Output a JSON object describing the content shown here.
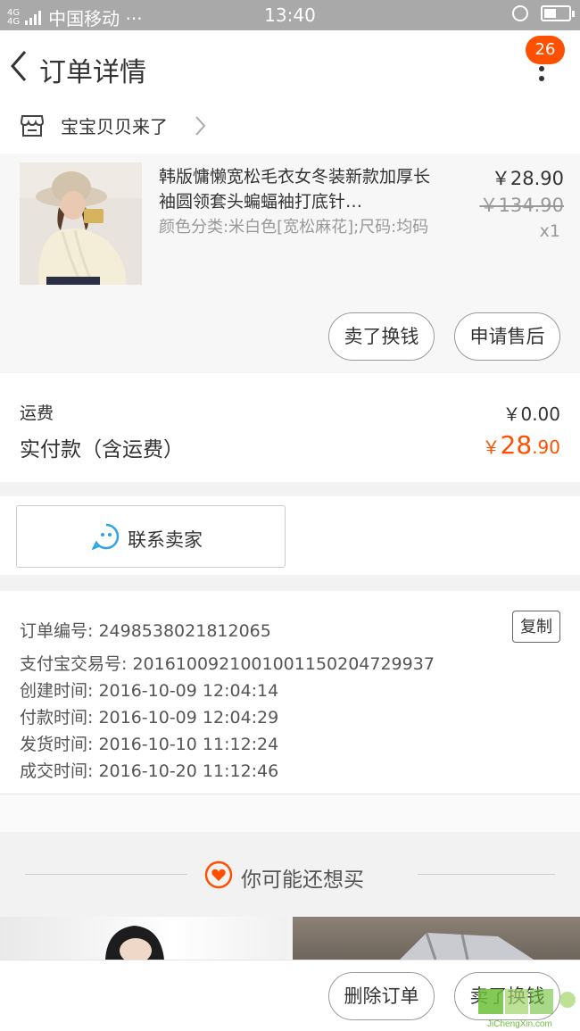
{
  "status_bar": {
    "network": "4G\n4G",
    "carrier": "中国移动 ···",
    "time": "13:40"
  },
  "nav": {
    "title": "订单详情",
    "badge_count": "26"
  },
  "shop": {
    "name": "宝宝贝贝来了"
  },
  "item": {
    "title": "韩版慵懒宽松毛衣女冬装新款加厚长袖圆领套头蝙蝠袖打底针…",
    "sku": "颜色分类:米白色[宽松麻花];尺码:均码",
    "price": "￥28.90",
    "original_price": "￥134.90",
    "quantity": "x1",
    "buttons": {
      "sell": "卖了换钱",
      "after_sale": "申请售后"
    }
  },
  "payment": {
    "shipping_label": "运费",
    "shipping_value": "￥0.00",
    "paid_label": "实付款（含运费）",
    "paid_currency": "￥",
    "paid_int": "28",
    "paid_dec": ".90"
  },
  "contact": {
    "label": "联系卖家"
  },
  "order_info": {
    "copy_label": "复制",
    "rows": [
      "订单编号: 2498538021812065",
      "支付宝交易号: 2016100921001001150204729937",
      "创建时间: 2016-10-09 12:04:14",
      "付款时间: 2016-10-09 12:04:29",
      "发货时间: 2016-10-10 11:12:24",
      "成交时间: 2016-10-20 11:12:46"
    ]
  },
  "recommend": {
    "title": "你可能还想买"
  },
  "bottom": {
    "delete_order": "删除订单",
    "sell": "卖了换钱"
  },
  "watermark": {
    "text": "JiChengXin.com"
  },
  "colors": {
    "accent": "#ff5000",
    "contact_icon": "#2aa3ea",
    "status_bar": "#a9a9a9"
  }
}
